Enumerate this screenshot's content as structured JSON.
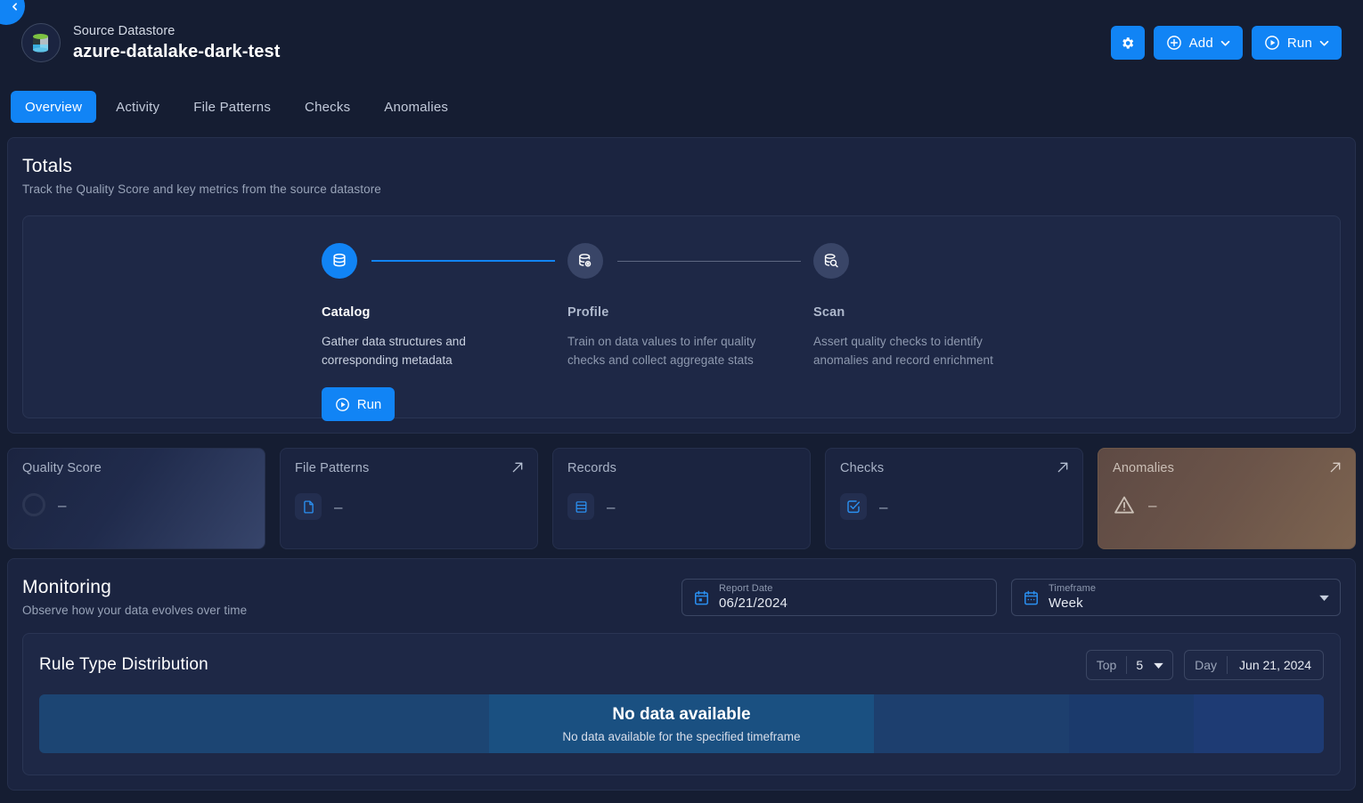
{
  "back_button": {
    "icon": "chevron-left-icon"
  },
  "header": {
    "eyebrow": "Source Datastore",
    "datastore_name": "azure-datalake-dark-test",
    "avatar_icon": "datastore-cylinder-icon",
    "actions": {
      "settings_icon": "gear-icon",
      "add_label": "Add",
      "add_icon": "plus-circle-icon",
      "run_label": "Run",
      "run_icon": "play-circle-icon",
      "caret_icon": "chevron-down-icon"
    }
  },
  "tabs": [
    {
      "label": "Overview",
      "active": true
    },
    {
      "label": "Activity",
      "active": false
    },
    {
      "label": "File Patterns",
      "active": false
    },
    {
      "label": "Checks",
      "active": false
    },
    {
      "label": "Anomalies",
      "active": false
    }
  ],
  "totals": {
    "title": "Totals",
    "subtitle": "Track the Quality Score and key metrics from the source datastore",
    "steps": [
      {
        "name": "Catalog",
        "description": "Gather data structures and corresponding metadata",
        "icon": "database-icon",
        "active": true,
        "run_label": "Run"
      },
      {
        "name": "Profile",
        "description": "Train on data values to infer quality checks and collect aggregate stats",
        "icon": "database-gear-icon",
        "active": false
      },
      {
        "name": "Scan",
        "description": "Assert quality checks to identify anomalies and record enrichment",
        "icon": "database-search-icon",
        "active": false
      }
    ]
  },
  "metrics": [
    {
      "label": "Quality Score",
      "value": "–",
      "icon": "score-ring-icon",
      "has_arrow": false,
      "style": "quality"
    },
    {
      "label": "File Patterns",
      "value": "–",
      "icon": "file-icon",
      "has_arrow": true,
      "style": "default"
    },
    {
      "label": "Records",
      "value": "–",
      "icon": "records-icon",
      "has_arrow": true,
      "style": "default"
    },
    {
      "label": "Checks",
      "value": "–",
      "icon": "check-square-icon",
      "has_arrow": true,
      "style": "default"
    },
    {
      "label": "Anomalies",
      "value": "–",
      "icon": "warning-triangle-icon",
      "has_arrow": true,
      "style": "anomalies"
    }
  ],
  "monitoring": {
    "title": "Monitoring",
    "subtitle": "Observe how your data evolves over time",
    "report_date": {
      "label": "Report Date",
      "value": "06/21/2024",
      "icon": "calendar-icon"
    },
    "timeframe": {
      "label": "Timeframe",
      "value": "Week",
      "icon": "calendar-range-icon",
      "caret": "chevron-down-icon"
    }
  },
  "rule_type_distribution": {
    "title": "Rule Type Distribution",
    "top_label": "Top",
    "top_value": "5",
    "day_label": "Day",
    "day_value": "Jun 21, 2024",
    "empty_title": "No data available",
    "empty_subtitle": "No data available for the specified timeframe"
  },
  "chart_data": {
    "type": "bar",
    "title": "Rule Type Distribution",
    "categories": [],
    "values": [],
    "series": [],
    "xlabel": "",
    "ylabel": "",
    "empty": true,
    "empty_message": "No data available",
    "empty_detail": "No data available for the specified timeframe",
    "top_n": 5,
    "granularity": "Day",
    "date": "Jun 21, 2024",
    "placeholder_bands": [
      {
        "width_pct": 35.0,
        "color": "#1c4573"
      },
      {
        "width_pct": 30.0,
        "color": "#1a5081"
      },
      {
        "width_pct": 15.2,
        "color": "#1d3f6e"
      },
      {
        "width_pct": 9.7,
        "color": "#1b3a6c"
      },
      {
        "width_pct": 10.1,
        "color": "#1e3b74"
      }
    ]
  }
}
